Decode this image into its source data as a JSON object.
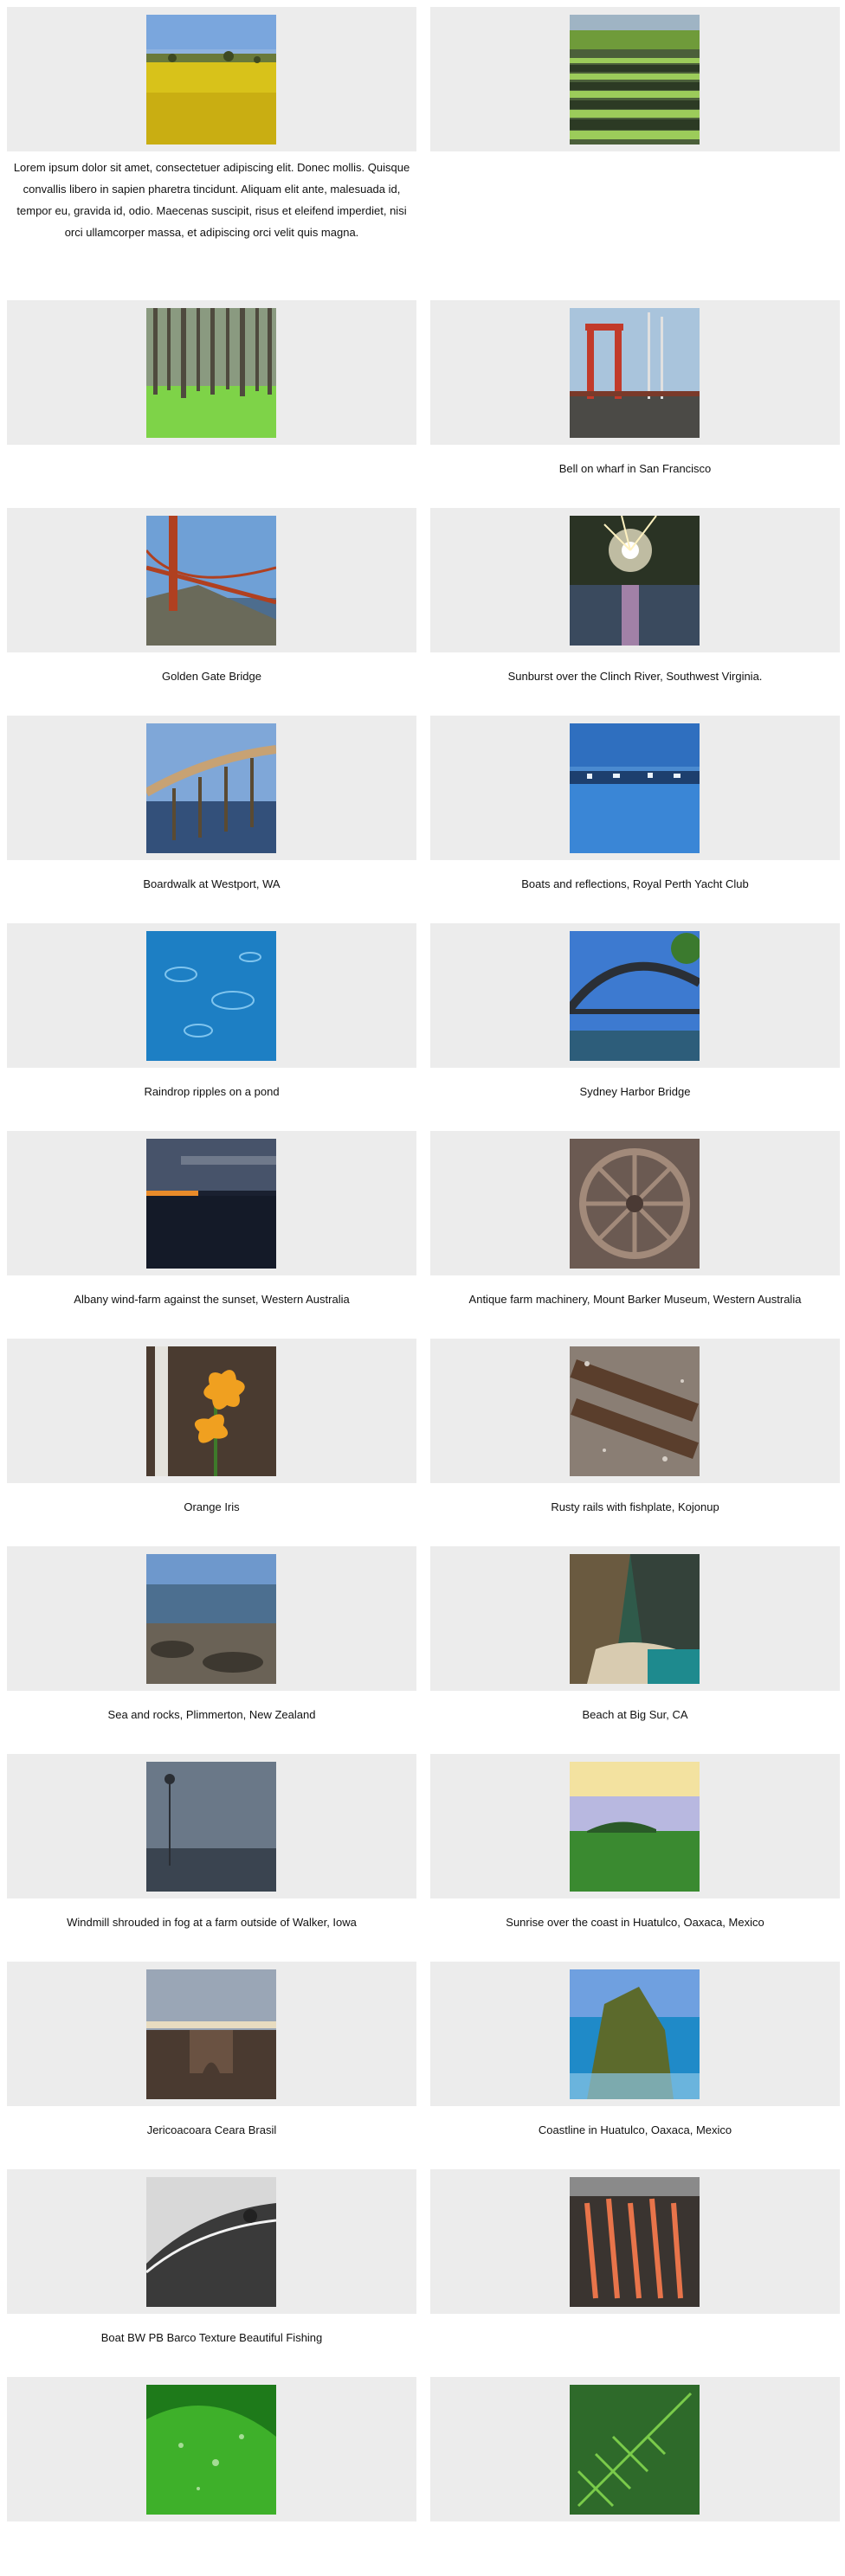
{
  "gallery": {
    "intro_text": "Lorem ipsum dolor sit amet, consectetuer adipiscing elit. Donec mollis. Quisque convallis libero in sapien pharetra tincidunt. Aliquam elit ante, malesuada id, tempor eu, gravida id, odio. Maecenas suscipit, risus et eleifend imperdiet, nisi orci ullamcorper massa, et adipiscing orci velit quis magna.",
    "items": [
      {
        "caption": "",
        "icon": "rapeseed-field-photo"
      },
      {
        "caption": "",
        "icon": "crop-rows-photo"
      },
      {
        "caption": "",
        "icon": "forest-photo"
      },
      {
        "caption": "Bell on wharf in San Francisco",
        "icon": "bell-wharf-photo"
      },
      {
        "caption": "Golden Gate Bridge",
        "icon": "golden-gate-photo"
      },
      {
        "caption": "Sunburst over the Clinch River, Southwest Virginia.",
        "icon": "sunburst-river-photo"
      },
      {
        "caption": "Boardwalk at Westport, WA",
        "icon": "boardwalk-photo"
      },
      {
        "caption": "Boats and reflections, Royal Perth Yacht Club",
        "icon": "boats-reflections-photo"
      },
      {
        "caption": "Raindrop ripples on a pond",
        "icon": "raindrop-ripples-photo"
      },
      {
        "caption": "Sydney Harbor Bridge",
        "icon": "sydney-bridge-photo"
      },
      {
        "caption": "Albany wind-farm against the sunset, Western Australia",
        "icon": "sunset-sea-photo"
      },
      {
        "caption": "Antique farm machinery, Mount Barker Museum, Western Australia",
        "icon": "wagon-wheel-photo"
      },
      {
        "caption": "Orange Iris",
        "icon": "orange-flower-photo"
      },
      {
        "caption": "Rusty rails with fishplate, Kojonup",
        "icon": "rusty-rails-photo"
      },
      {
        "caption": "Sea and rocks, Plimmerton, New Zealand",
        "icon": "sea-rocks-photo"
      },
      {
        "caption": "Beach at Big Sur, CA",
        "icon": "big-sur-beach-photo"
      },
      {
        "caption": "Windmill shrouded in fog at a farm outside of Walker, Iowa",
        "icon": "foggy-windmill-photo"
      },
      {
        "caption": "Sunrise over the coast in Huatulco, Oaxaca, Mexico",
        "icon": "coast-sunrise-photo"
      },
      {
        "caption": "Jericoacoara Ceara Brasil",
        "icon": "rock-arch-photo"
      },
      {
        "caption": "Coastline in Huatulco, Oaxaca, Mexico",
        "icon": "coastline-photo"
      },
      {
        "caption": "Boat BW PB Barco Texture Beautiful Fishing",
        "icon": "bw-boat-photo"
      },
      {
        "caption": "",
        "icon": "campfire-logs-photo"
      },
      {
        "caption": "",
        "icon": "green-leaf-photo"
      },
      {
        "caption": "",
        "icon": "fern-photo"
      }
    ]
  }
}
